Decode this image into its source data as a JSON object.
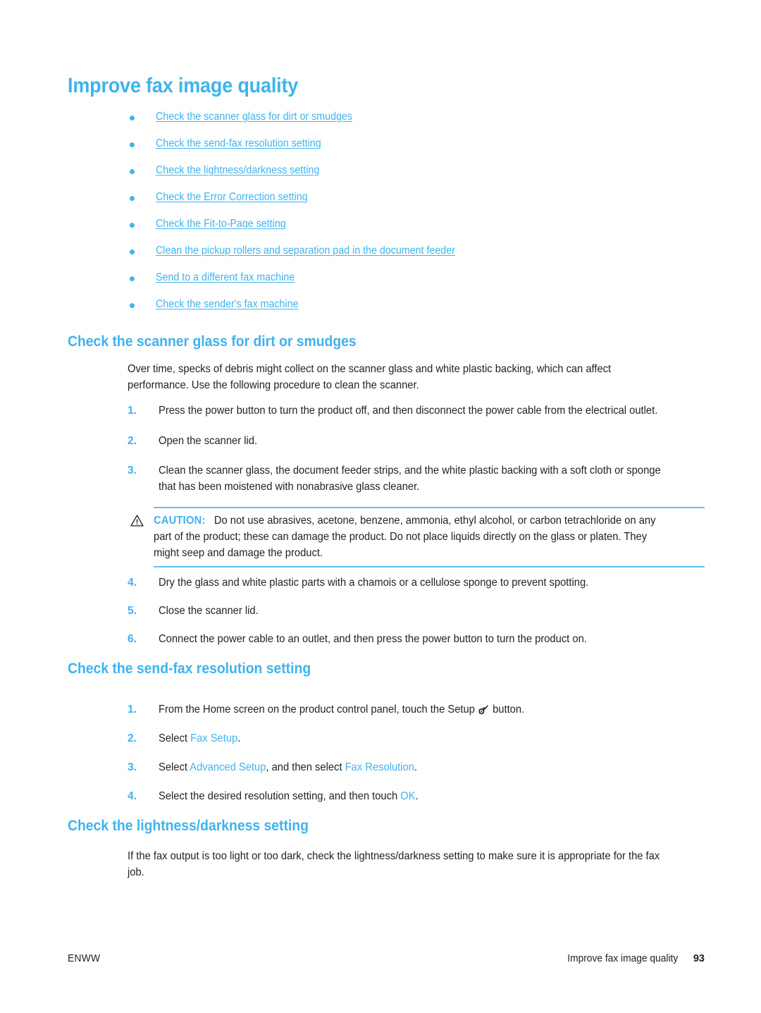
{
  "page": {
    "title": "Improve fax image quality",
    "accent_color": "#3fb3ee",
    "text_color": "#231f20",
    "background_color": "#ffffff"
  },
  "toc": {
    "items": [
      {
        "label": "Check the scanner glass for dirt or smudges"
      },
      {
        "label": "Check the send-fax resolution setting"
      },
      {
        "label": "Check the lightness/darkness setting"
      },
      {
        "label": "Check the Error Correction setting"
      },
      {
        "label": "Check the Fit-to-Page setting"
      },
      {
        "label": "Clean the pickup rollers and separation pad in the document feeder"
      },
      {
        "label": "Send to a different fax machine"
      },
      {
        "label": "Check the sender's fax machine"
      }
    ]
  },
  "sections": {
    "scanner_glass": {
      "heading": "Check the scanner glass for dirt or smudges",
      "intro": "Over time, specks of debris might collect on the scanner glass and white plastic backing, which can affect performance. Use the following procedure to clean the scanner.",
      "steps": [
        {
          "num": "1.",
          "text": "Press the power button to turn the product off, and then disconnect the power cable from the electrical outlet."
        },
        {
          "num": "2.",
          "text": "Open the scanner lid."
        },
        {
          "num": "3.",
          "text": "Clean the scanner glass, the document feeder strips, and the white plastic backing with a soft cloth or sponge that has been moistened with nonabrasive glass cleaner."
        },
        {
          "num": "4.",
          "text": "Dry the glass and white plastic parts with a chamois or a cellulose sponge to prevent spotting."
        },
        {
          "num": "5.",
          "text": "Close the scanner lid."
        },
        {
          "num": "6.",
          "text": "Connect the power cable to an outlet, and then press the power button to turn the product on."
        }
      ],
      "caution": {
        "icon": "warning-triangle-icon",
        "label": "CAUTION:",
        "text": "Do not use abrasives, acetone, benzene, ammonia, ethyl alcohol, or carbon tetrachloride on any part of the product; these can damage the product. Do not place liquids directly on the glass or platen. They might seep and damage the product."
      }
    },
    "send_fax_resolution": {
      "heading": "Check the send-fax resolution setting",
      "steps": {
        "step1_prefix": "From the Home screen on the product control panel, touch the Setup ",
        "step1_icon": "setup-wrench-gear-icon",
        "step1_suffix": " button.",
        "step1_num": "1.",
        "step2_num": "2.",
        "step2_prefix": "Select ",
        "step2_term": "Fax Setup",
        "step2_suffix": ".",
        "step3_num": "3.",
        "step3_prefix": "Select ",
        "step3_term1": "Advanced Setup",
        "step3_middle": ", and then select ",
        "step3_term2": "Fax Resolution",
        "step3_suffix": ".",
        "step4_num": "4.",
        "step4_prefix": "Select the desired resolution setting, and then touch ",
        "step4_term": "OK",
        "step4_suffix": "."
      }
    },
    "lightness_darkness": {
      "heading": "Check the lightness/darkness setting",
      "body": "If the fax output is too light or too dark, check the lightness/darkness setting to make sure it is appropriate for the fax job."
    }
  },
  "footer": {
    "left": "ENWW",
    "chapter": "Improve fax image quality",
    "page_number": "93"
  }
}
